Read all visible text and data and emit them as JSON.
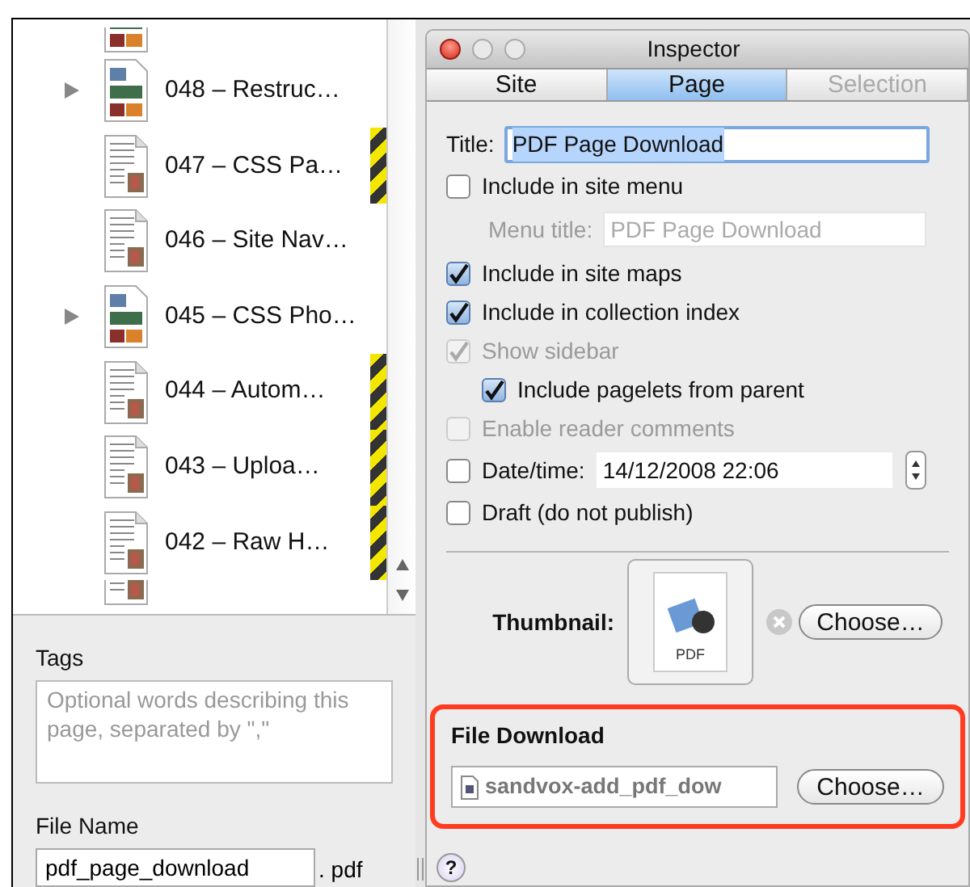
{
  "outline": {
    "items": [
      {
        "kind": "collection",
        "label": "048 – Restruc…",
        "flagged": false
      },
      {
        "kind": "page",
        "label": "047 – CSS Pa…",
        "flagged": true
      },
      {
        "kind": "page",
        "label": "046 – Site Nav…",
        "flagged": false
      },
      {
        "kind": "collection",
        "label": "045 – CSS Pho…",
        "flagged": false
      },
      {
        "kind": "page",
        "label": "044 – Autom…",
        "flagged": true
      },
      {
        "kind": "page",
        "label": "043 – Uploa…",
        "flagged": true
      },
      {
        "kind": "page",
        "label": "042 – Raw H…",
        "flagged": true
      }
    ]
  },
  "page_details": {
    "tags_label": "Tags",
    "tags_placeholder": "Optional words describing this page, separated by \",\"",
    "file_name_label": "File Name",
    "file_name": "pdf_page_download",
    "extension": ". pdf"
  },
  "inspector": {
    "title": "Inspector",
    "tabs": [
      {
        "label": "Site",
        "selected": false,
        "disabled": false
      },
      {
        "label": "Page",
        "selected": true,
        "disabled": false
      },
      {
        "label": "Selection",
        "selected": false,
        "disabled": true
      }
    ],
    "title_field": {
      "label": "Title:",
      "value": "PDF Page Download"
    },
    "options": [
      {
        "kind": "checkbox",
        "label": "Include in site menu",
        "checked": false,
        "disabled": false
      },
      {
        "kind": "field",
        "label": "Menu title:",
        "placeholder": "PDF Page Download",
        "disabled": true
      },
      {
        "kind": "checkbox",
        "label": "Include in site maps",
        "checked": true,
        "disabled": false
      },
      {
        "kind": "checkbox",
        "label": "Include in collection index",
        "checked": true,
        "disabled": false
      },
      {
        "kind": "checkbox",
        "label": "Show sidebar",
        "checked": true,
        "disabled": true,
        "children": [
          {
            "kind": "checkbox",
            "label": "Include pagelets from parent",
            "checked": true,
            "disabled": false
          }
        ]
      },
      {
        "kind": "checkbox",
        "label": "Enable reader comments",
        "checked": false,
        "disabled": true
      },
      {
        "kind": "datetime",
        "label": "Date/time:",
        "value": "14/12/2008 22:06",
        "checked": false,
        "disabled": false
      },
      {
        "kind": "checkbox",
        "label": "Draft (do not publish)",
        "checked": false,
        "disabled": false
      }
    ],
    "thumbnail": {
      "label": "Thumbnail:",
      "badge": "PDF",
      "button": "Choose…"
    },
    "file_download": {
      "label": "File Download",
      "file": "sandvox-add_pdf_dow",
      "button": "Choose…",
      "highlighted": true
    },
    "help_button": "?"
  }
}
